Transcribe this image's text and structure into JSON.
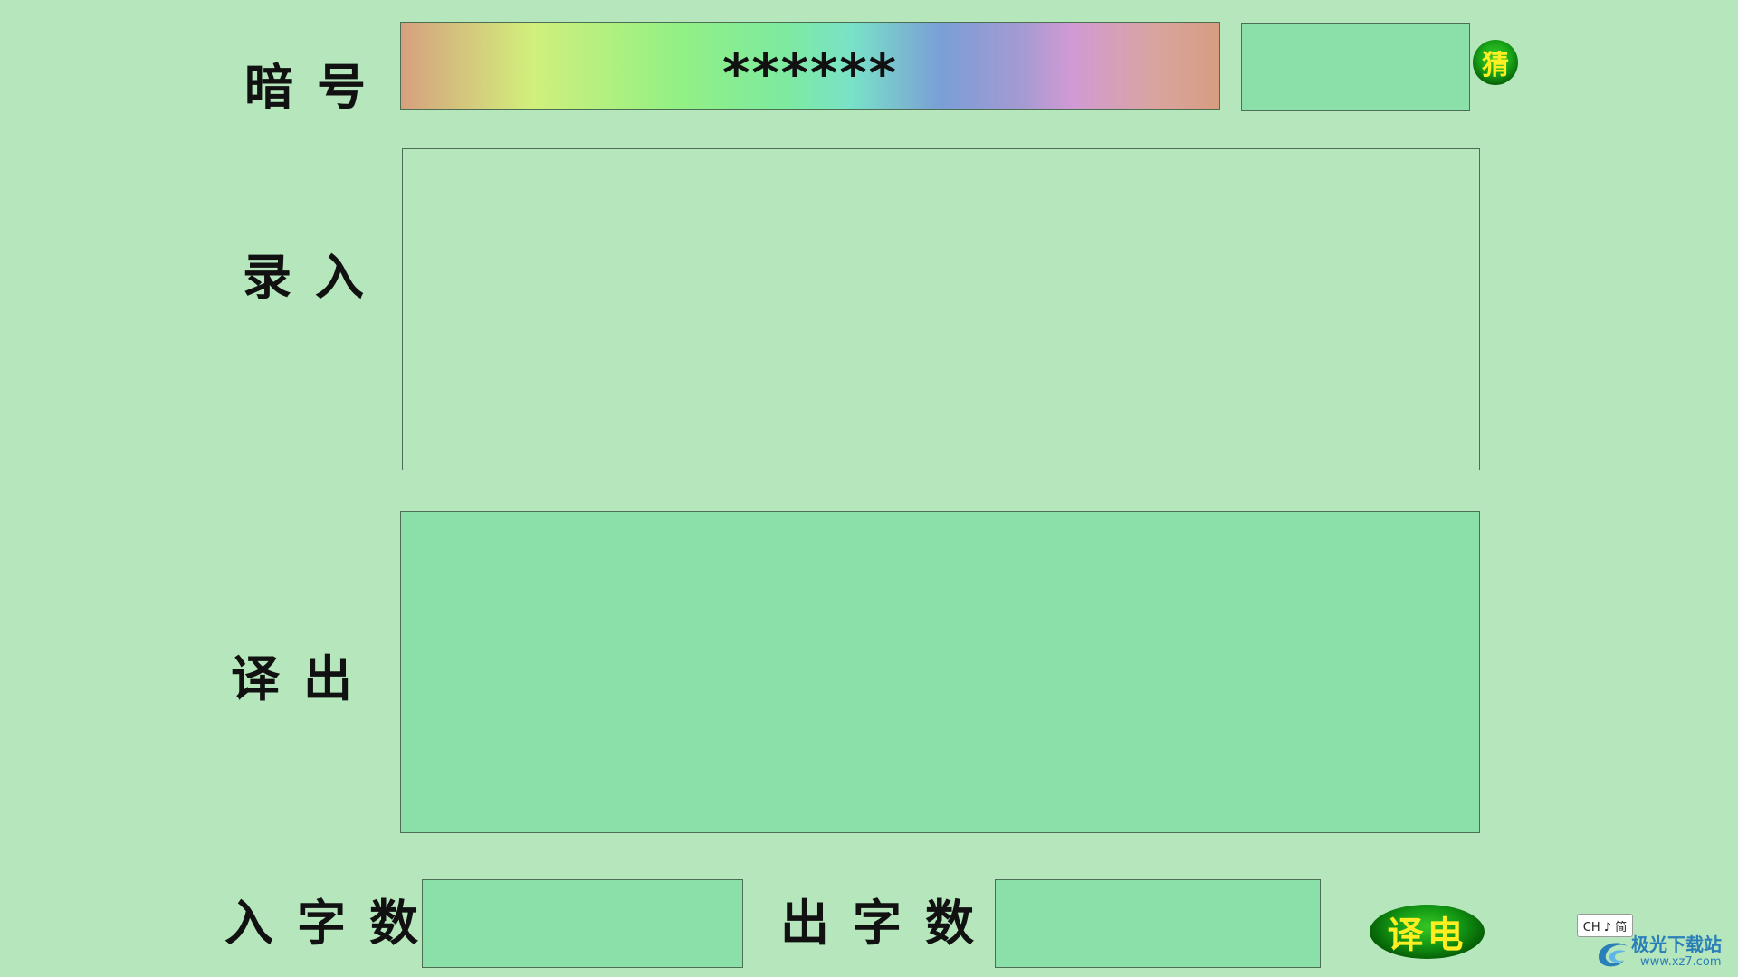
{
  "labels": {
    "cipher": "暗号",
    "input": "录入",
    "output": "译出",
    "input_count": "入字数",
    "output_count": "出字数"
  },
  "cipher_field": {
    "value": "******"
  },
  "cipher_extra_field": {
    "value": ""
  },
  "guess_button": {
    "label": "猜"
  },
  "input_area": {
    "value": ""
  },
  "output_area": {
    "value": ""
  },
  "input_count_field": {
    "value": ""
  },
  "output_count_field": {
    "value": ""
  },
  "translate_button": {
    "label": "译电"
  },
  "ime_indicator": {
    "text": "CH ♪ 简"
  },
  "watermark": {
    "site": "极光下载站",
    "url": "www.xz7.com"
  },
  "colors": {
    "background": "#b5e6bc",
    "field_dark": "#8ae0a8",
    "button_green": "#149a14",
    "button_text": "#ffee22"
  }
}
